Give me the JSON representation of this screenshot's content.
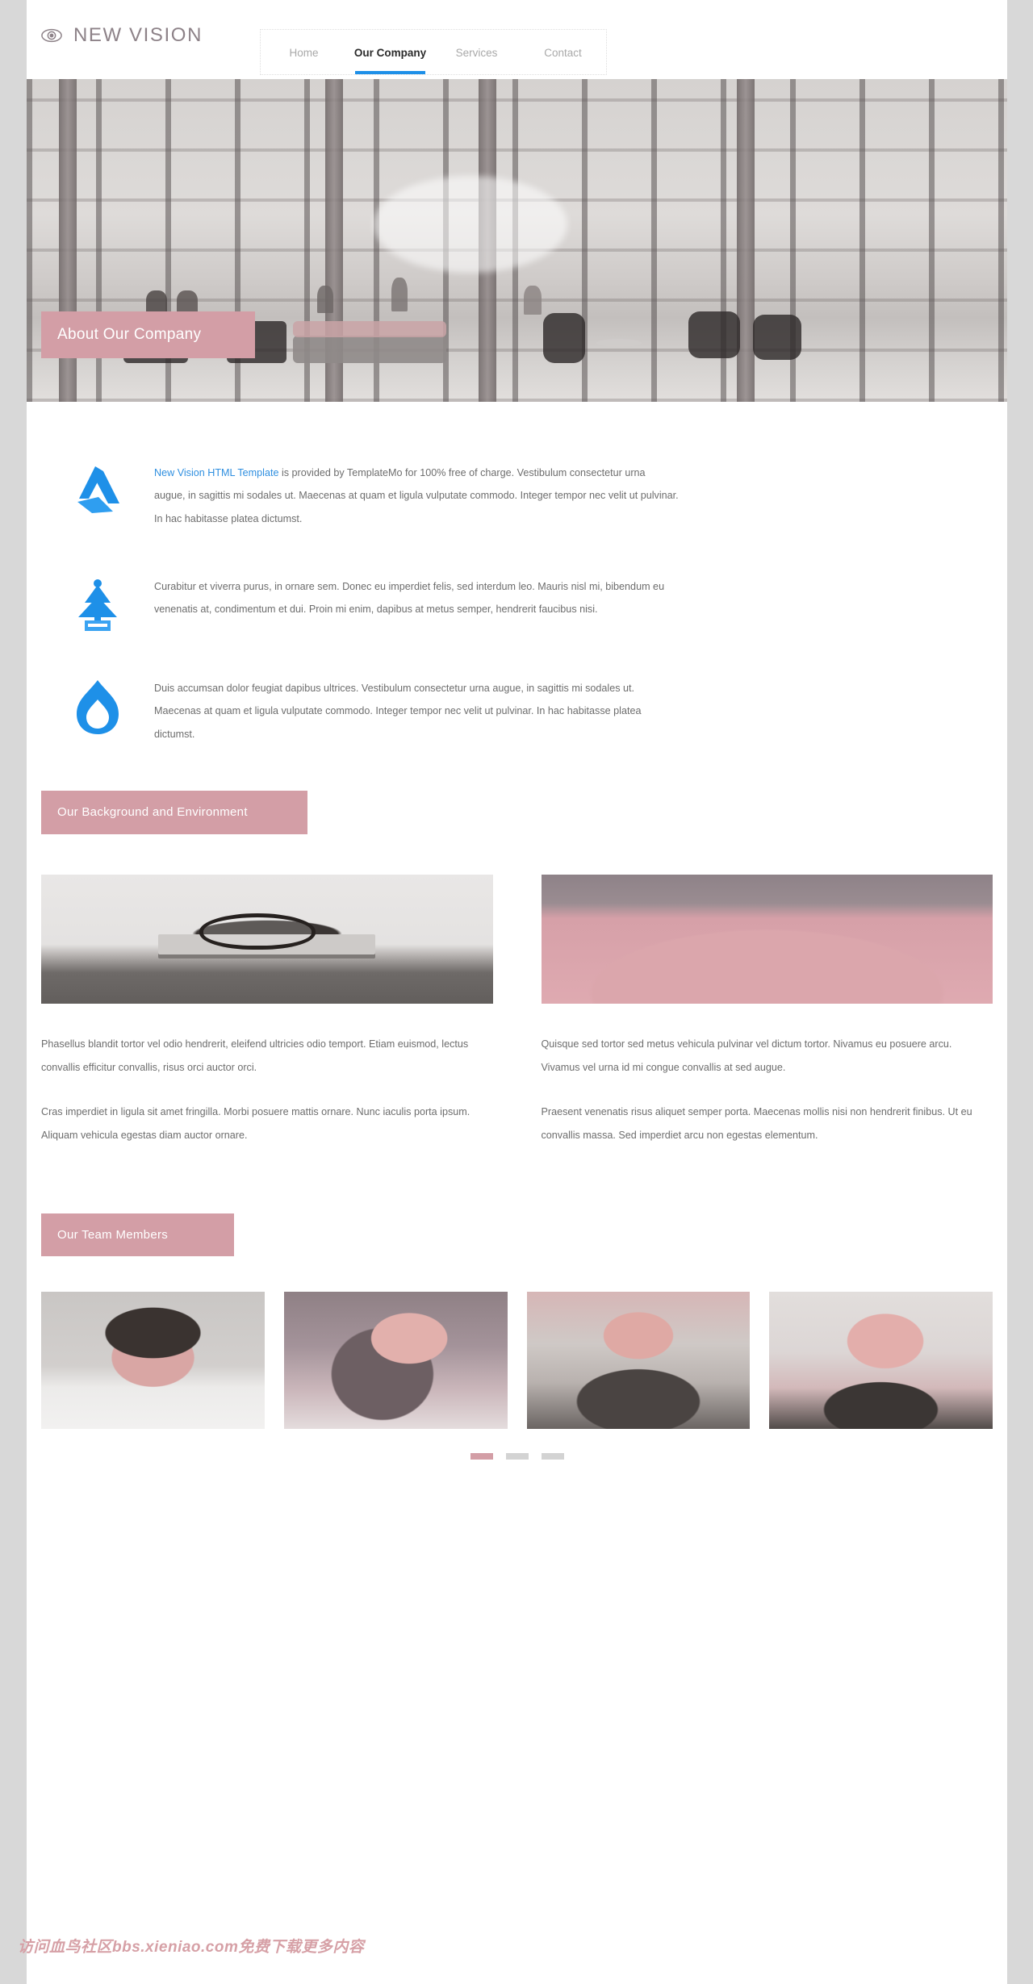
{
  "site": {
    "logo_icon": "eye-icon",
    "logo_text": "NEW VISION"
  },
  "nav": {
    "items": [
      {
        "label": "Home",
        "active": false
      },
      {
        "label": "Our Company",
        "active": true
      },
      {
        "label": "Services",
        "active": false
      },
      {
        "label": "Contact",
        "active": false
      }
    ],
    "active_accent": "#1e90e8"
  },
  "hero": {
    "alt": "Modern glass atrium lobby with people seated in lounge furniture"
  },
  "about": {
    "banner_title": "About Our Company",
    "banner_color": "#d39ea6",
    "features": [
      {
        "icon": "origami-bird-icon",
        "link_text": "New Vision HTML Template",
        "text": " is provided by TemplateMo for 100% free of charge. Vestibulum consectetur urna augue, in sagittis mi sodales ut. Maecenas at quam et ligula vulputate commodo. Integer tempor nec velit ut pulvinar. In hac habitasse platea dictumst."
      },
      {
        "icon": "pine-tree-icon",
        "link_text": "",
        "text": "Curabitur et viverra purus, in ornare sem. Donec eu imperdiet felis, sed interdum leo. Mauris nisl mi, bibendum eu venenatis at, condimentum et dui. Proin mi enim, dapibus at metus semper, hendrerit faucibus nisi."
      },
      {
        "icon": "flame-icon",
        "link_text": "",
        "text": "Duis accumsan dolor feugiat dapibus ultrices. Vestibulum consectetur urna augue, in sagittis mi sodales ut. Maecenas at quam et ligula vulputate commodo. Integer tempor nec velit ut pulvinar. In hac habitasse platea dictumst."
      }
    ],
    "icon_color": "#1e90e8"
  },
  "background_section": {
    "banner_title": "Our Background and Environment",
    "columns": [
      {
        "image_alt": "Laptop with eyeglasses, phone and mouse on a desk",
        "paragraphs": [
          "Phasellus blandit tortor vel odio hendrerit, eleifend ultricies odio temport. Etiam euismod, lectus convallis efficitur convallis, risus orci auctor orci.",
          "Cras imperdiet in ligula sit amet fringilla. Morbi posuere mattis ornare. Nunc iaculis porta ipsum. Aliquam vehicula egestas diam auctor ornare."
        ]
      },
      {
        "image_alt": "Pink toned abstract landscape photograph",
        "paragraphs": [
          "Quisque sed tortor sed metus vehicula pulvinar vel dictum tortor. Nivamus eu posuere arcu. Vivamus vel urna id mi congue convallis at sed augue.",
          "Praesent venenatis risus aliquet semper porta. Maecenas mollis nisi non hendrerit finibus. Ut eu convallis massa. Sed imperdiet arcu non egestas elementum."
        ]
      }
    ]
  },
  "team_section": {
    "banner_title": "Our Team Members",
    "members": [
      {
        "photo_alt": "Young man in white t-shirt with star graphic"
      },
      {
        "photo_alt": "Smiling woman with long hair"
      },
      {
        "photo_alt": "Bearded man in dark printed t-shirt"
      },
      {
        "photo_alt": "Smiling blonde woman in dark top"
      }
    ],
    "carousel": {
      "dots": [
        {
          "active": true
        },
        {
          "active": false
        },
        {
          "active": false
        }
      ],
      "active_color": "#d39ea6",
      "inactive_color": "#d3d3d3"
    }
  },
  "watermark": {
    "text": "访问血鸟社区bbs.xieniao.com免费下载更多内容",
    "color": "#d6a0a6"
  }
}
